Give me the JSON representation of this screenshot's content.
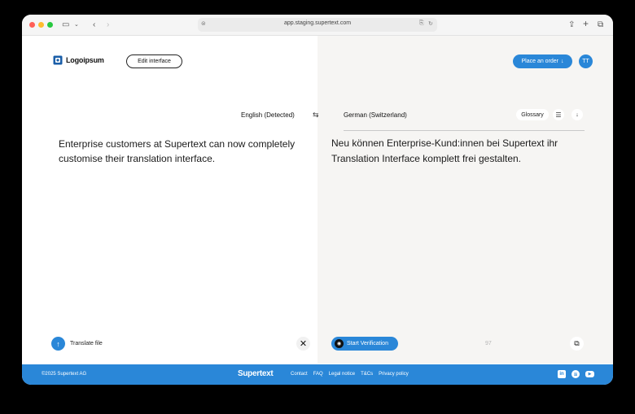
{
  "browser": {
    "url": "app.staging.supertext.com"
  },
  "header": {
    "logo_text": "Logoipsum",
    "edit_interface_label": "Edit interface",
    "place_order_label": "Place an order",
    "avatar_initials": "TT"
  },
  "languages": {
    "source": "English (Detected)",
    "target": "German (Switzerland)"
  },
  "toolbar": {
    "glossary_label": "Glossary"
  },
  "source": {
    "text": "Enterprise customers at Supertext can now completely customise their translation interface.",
    "translate_file_label": "Translate file"
  },
  "target": {
    "text": "Neu können Enterprise-Kund:innen bei Supertext ihr Translation Interface komplett frei gestalten.",
    "verification_label": "Start Verification",
    "char_count": "97"
  },
  "footer": {
    "copyright": "©2025 Supertext AG",
    "logo_text": "Supertext",
    "links": [
      "Contact",
      "FAQ",
      "Legal notice",
      "T&Cs",
      "Privacy policy"
    ]
  },
  "colors": {
    "accent": "#2a87d8",
    "target_background": "#f6f5f3"
  },
  "icons": {
    "swap": "swap-arrows-icon",
    "sliders": "sliders-icon",
    "download": "download-icon",
    "upload": "upload-icon",
    "close": "close-icon",
    "copy": "copy-icon",
    "verify": "user-check-icon"
  }
}
